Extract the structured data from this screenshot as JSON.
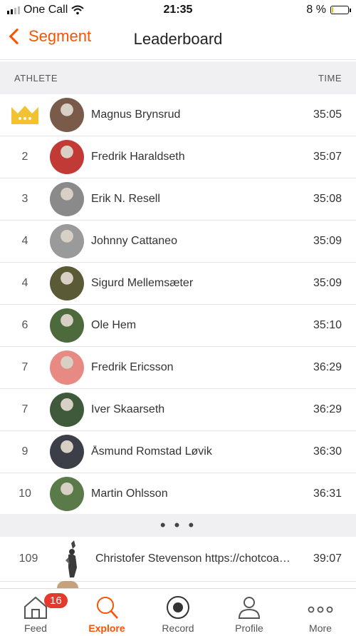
{
  "status_bar": {
    "carrier": "One Call",
    "time": "21:35",
    "battery_text": "8 %",
    "battery_level": 0.08
  },
  "nav": {
    "back_label": "Segment",
    "title": "Leaderboard"
  },
  "columns": {
    "athlete": "ATHLETE",
    "time": "TIME"
  },
  "leaderboard": [
    {
      "rank": "",
      "crown": true,
      "name": "Magnus Brynsrud",
      "time": "35:05",
      "avatar_color": "#7a5b4a"
    },
    {
      "rank": "2",
      "name": "Fredrik Haraldseth",
      "time": "35:07",
      "avatar_color": "#c23a36"
    },
    {
      "rank": "3",
      "name": "Erik N. Resell",
      "time": "35:08",
      "avatar_color": "#8a8a8a"
    },
    {
      "rank": "4",
      "name": "Johnny Cattaneo",
      "time": "35:09",
      "avatar_color": "#9a9a9a"
    },
    {
      "rank": "4",
      "name": "Sigurd Mellemsæter",
      "time": "35:09",
      "avatar_color": "#5b5a36"
    },
    {
      "rank": "6",
      "name": "Ole Hem",
      "time": "35:10",
      "avatar_color": "#4c6a3c"
    },
    {
      "rank": "7",
      "name": "Fredrik Ericsson",
      "time": "36:29",
      "avatar_color": "#e88a84"
    },
    {
      "rank": "7",
      "name": "Iver  Skaarseth",
      "time": "36:29",
      "avatar_color": "#3e5a3a"
    },
    {
      "rank": "9",
      "name": "Åsmund Romstad Løvik",
      "time": "36:30",
      "avatar_color": "#3c3f48"
    },
    {
      "rank": "10",
      "name": "Martin Ohlsson",
      "time": "36:31",
      "avatar_color": "#5a7a4a"
    }
  ],
  "more_indicator": "• • •",
  "far_entry": {
    "rank": "109",
    "name": "Christofer Stevenson https://chotcoaching.com",
    "time": "39:07"
  },
  "tabs": [
    {
      "label": "Feed",
      "icon": "home-icon",
      "badge": "16",
      "active": false
    },
    {
      "label": "Explore",
      "icon": "search-icon",
      "active": true
    },
    {
      "label": "Record",
      "icon": "record-icon",
      "active": false
    },
    {
      "label": "Profile",
      "icon": "profile-icon",
      "active": false
    },
    {
      "label": "More",
      "icon": "more-icon",
      "active": false
    }
  ],
  "colors": {
    "accent": "#fc5200",
    "badge": "#e23b2e",
    "crown": "#f2c230"
  }
}
